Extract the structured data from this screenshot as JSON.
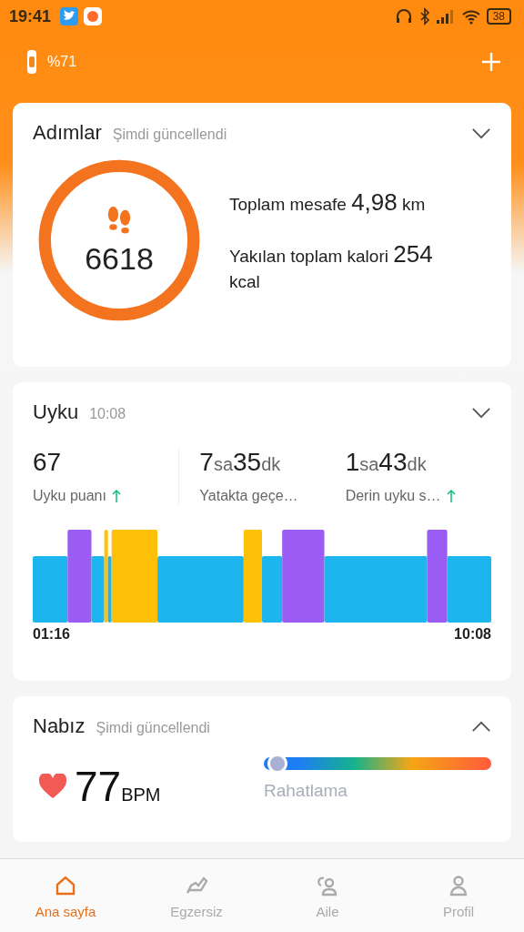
{
  "status_bar": {
    "time": "19:41",
    "battery": "38"
  },
  "header": {
    "band_battery": "%71"
  },
  "steps_card": {
    "title": "Adımlar",
    "updated": "Şimdi güncellendi",
    "steps": "6618",
    "stats": [
      {
        "label": "Toplam mesafe",
        "value": "4,98",
        "unit": "km"
      },
      {
        "label": "Yakılan toplam kalori",
        "value": "254",
        "unit": "kcal"
      }
    ]
  },
  "sleep_card": {
    "title": "Uyku",
    "time": "10:08",
    "metrics": [
      {
        "parts": [
          {
            "value": "67"
          }
        ],
        "label": "Uyku puanı",
        "trend_up": true
      },
      {
        "parts": [
          {
            "value": "7",
            "unit": "sa"
          },
          {
            "value": "35",
            "unit": "dk"
          }
        ],
        "label": "Yatakta geçe…",
        "trend_up": false
      },
      {
        "parts": [
          {
            "value": "1",
            "unit": "sa"
          },
          {
            "value": "43",
            "unit": "dk"
          }
        ],
        "label": "Derin uyku s…",
        "trend_up": true
      }
    ],
    "start": "01:16",
    "end": "10:08"
  },
  "heart_card": {
    "title": "Nabız",
    "updated": "Şimdi güncellendi",
    "bpm": "77",
    "unit": "BPM",
    "level": 0.03,
    "zone": "Rahatlama"
  },
  "tabs": [
    {
      "label": "Ana sayfa",
      "selected": true
    },
    {
      "label": "Egzersiz",
      "selected": false
    },
    {
      "label": "Aile",
      "selected": false
    },
    {
      "label": "Profil",
      "selected": false
    }
  ]
}
